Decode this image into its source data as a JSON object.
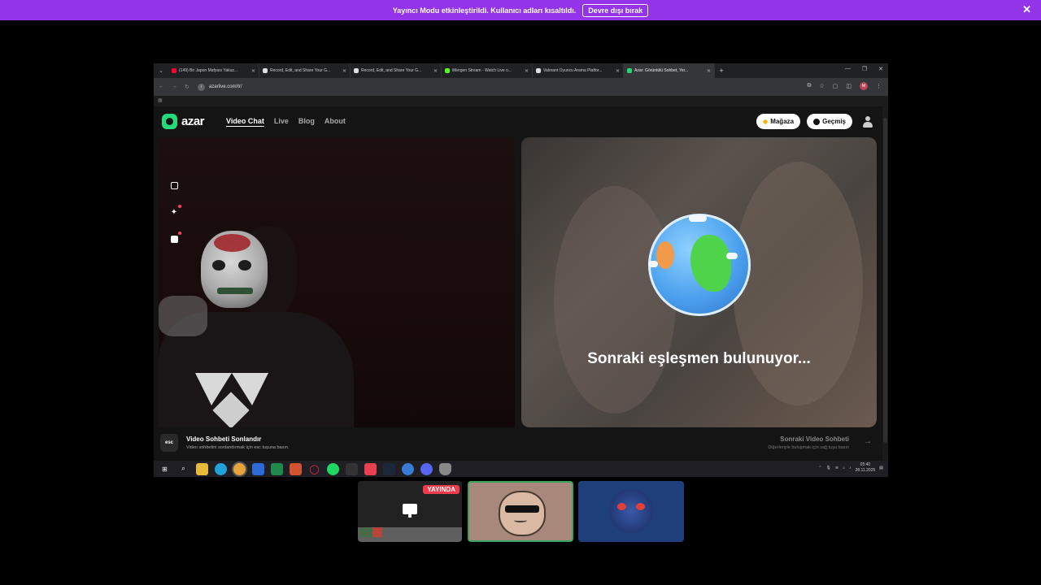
{
  "banner": {
    "text": "Yayıncı Modu etkinleştirildi. Kullanıcı adları kısaltıldı.",
    "button": "Devre dışı bırak",
    "close": "✕"
  },
  "browser": {
    "tabs": [
      {
        "title": "(149) Bir Japon Mafyası Yakuz...",
        "color": "#ff0033"
      },
      {
        "title": "Record, Edit, and Share Your G...",
        "color": "#dddddd"
      },
      {
        "title": "Record, Edit, and Share Your G...",
        "color": "#dddddd"
      },
      {
        "title": "iMergen Stream - Watch Live o...",
        "color": "#53fc18"
      },
      {
        "title": "Valorant Oyuncu Arama Platfor...",
        "color": "#dddddd"
      },
      {
        "title": "Azar: Görüntülü Sohbet, Yer...",
        "color": "#22d97b"
      }
    ],
    "url": "azarlive.com/tr/",
    "profile_initial": "M"
  },
  "azar": {
    "logo": "azar",
    "nav": [
      "Video Chat",
      "Live",
      "Blog",
      "About"
    ],
    "shop_label": "Mağaza",
    "history_label": "Geçmiş",
    "searching_text": "Sonraki eşleşmen bulunuyor...",
    "footer": {
      "esc_key": "esc",
      "end_title": "Video Sohbeti Sonlandır",
      "end_sub": "Video sohbetini sonlandırmak için esc tuşuna basın.",
      "next_title": "Sonraki Video Sohbeti",
      "next_sub": "Diğerleriyle buluşmak için sağ tuşa basın",
      "next_arrow": "→"
    }
  },
  "taskbar": {
    "time": "05:40",
    "date": "28.11.2025"
  },
  "participants": {
    "live_badge": "YAYINDA"
  },
  "colors": {
    "banner": "#9333ea",
    "azar_green": "#22d97b",
    "live_red": "#ef3b4a",
    "speaking_border": "#3ba55d"
  }
}
